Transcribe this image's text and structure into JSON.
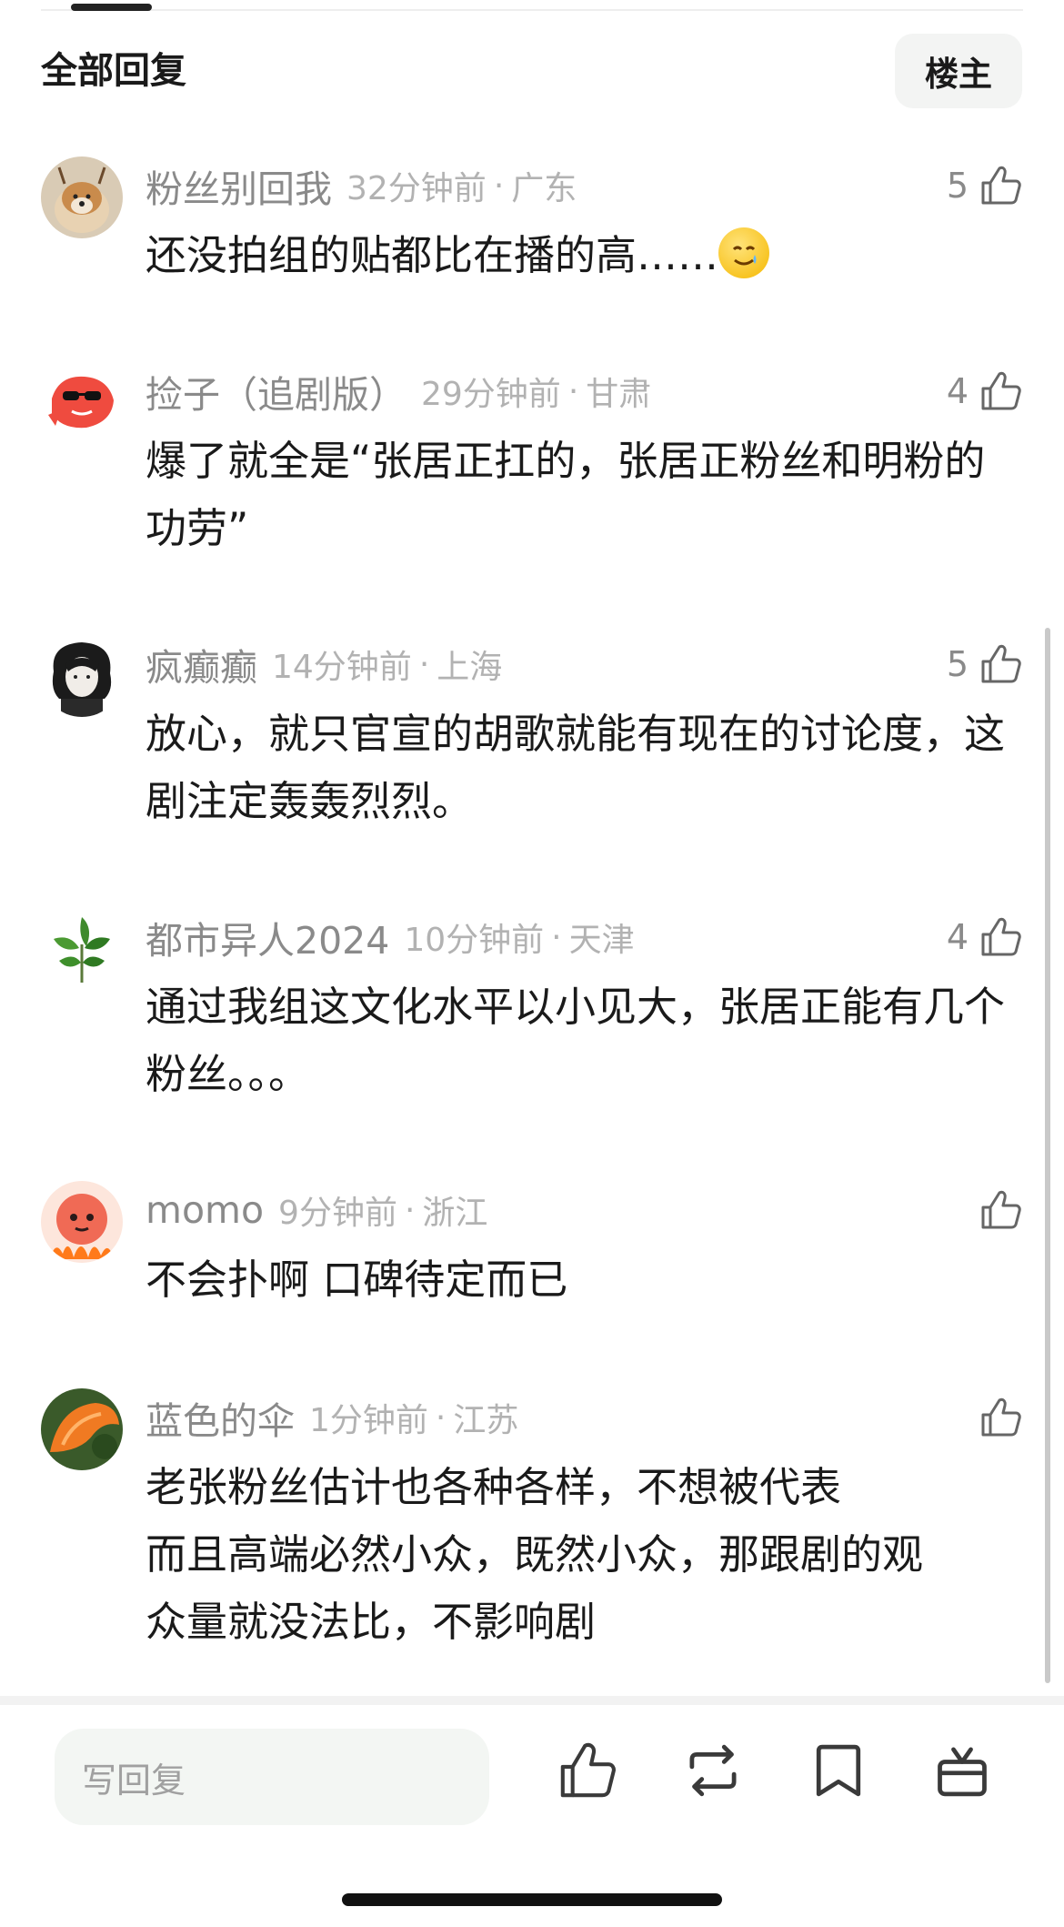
{
  "header": {
    "title": "全部回复",
    "op_label": "楼主"
  },
  "comments": [
    {
      "user": "粉丝别回我",
      "time": "32分钟前",
      "location": "广东",
      "likes": "5",
      "text": "还没拍组的贴都比在播的高……",
      "emoji": "crying-smile-emoji"
    },
    {
      "user": "捡子（追剧版）",
      "time": "29分钟前",
      "location": "甘肃",
      "likes": "4",
      "text": "爆了就全是“张居正扛的，张居正粉丝和明粉的功劳”"
    },
    {
      "user": "疯癫癫",
      "time": "14分钟前",
      "location": "上海",
      "likes": "5",
      "text": "放心，就只官宣的胡歌就能有现在的讨论度，这剧注定轰轰烈烈。"
    },
    {
      "user": "都市异人2024",
      "time": "10分钟前",
      "location": "天津",
      "likes": "4",
      "text": "通过我组这文化水平以小见大，张居正能有几个粉丝。。。"
    },
    {
      "user": "momo",
      "time": "9分钟前",
      "location": "浙江",
      "likes": "",
      "text": "不会扑啊 口碑待定而已"
    },
    {
      "user": "蓝色的伞",
      "time": "1分钟前",
      "location": "江苏",
      "likes": "",
      "text_lines": [
        "老张粉丝估计也各种各样，不想被代表",
        "而且高端必然小众，既然小众，那跟剧的观",
        "众量就没法比，不影响剧"
      ]
    }
  ],
  "meta_separator": "·",
  "bottom_bar": {
    "reply_placeholder": "写回复",
    "icons": [
      "thumbs-up-icon",
      "repost-icon",
      "bookmark-icon",
      "gift-icon"
    ]
  },
  "colors": {
    "username": "#8a8a8a",
    "timestamp": "#b2b2b2",
    "body": "#1a1a1a",
    "input_bg": "#f3f6f3"
  }
}
